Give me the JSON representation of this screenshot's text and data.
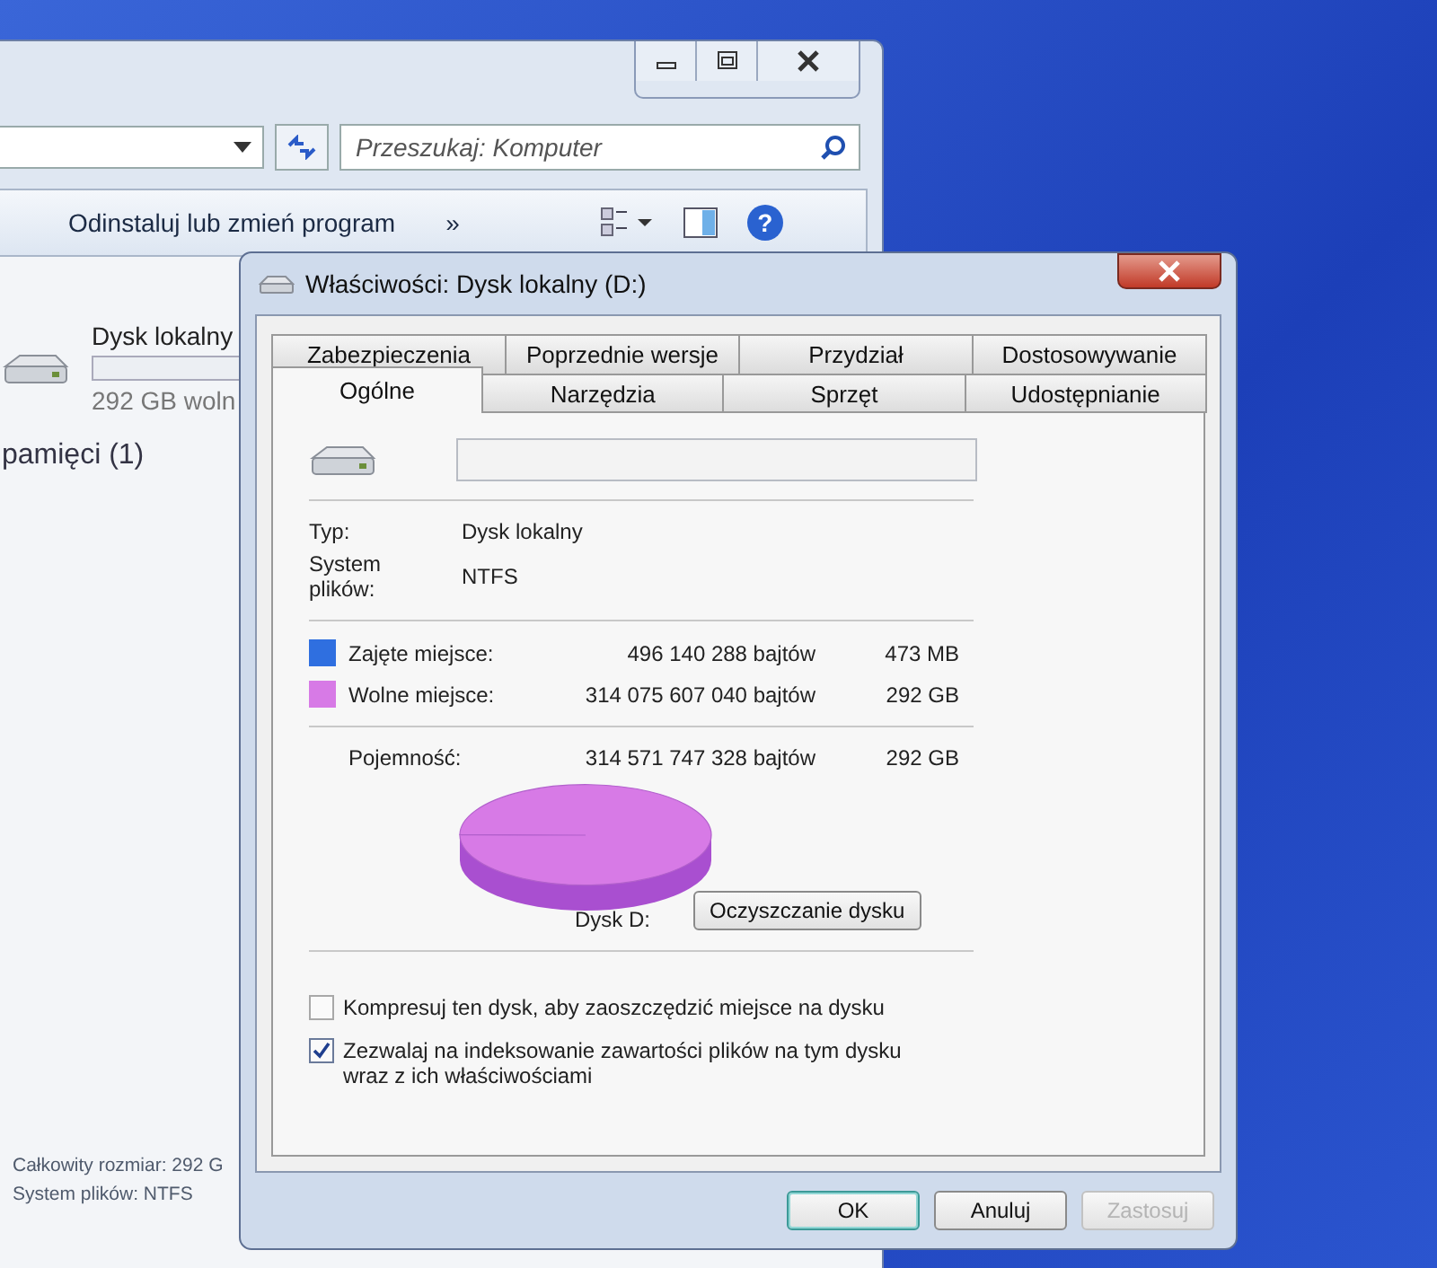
{
  "explorer": {
    "search_placeholder": "Przeszukaj: Komputer",
    "toolbar_item": "Odinstaluj lub zmień program",
    "more": "»",
    "help_glyph": "?",
    "drive": {
      "name": "Dysk lokalny",
      "free": "292 GB woln"
    },
    "group_heading": "pamięci (1)",
    "details": [
      "Całkowity rozmiar: 292 G",
      "System plików: NTFS"
    ]
  },
  "dialog": {
    "title": "Właściwości: Dysk lokalny (D:)",
    "tab_rows": [
      [
        {
          "label": "Zabezpieczenia",
          "selected": false
        },
        {
          "label": "Poprzednie wersje",
          "selected": false
        },
        {
          "label": "Przydział",
          "selected": false
        },
        {
          "label": "Dostosowywanie",
          "selected": false
        }
      ],
      [
        {
          "label": "Ogólne",
          "selected": true
        },
        {
          "label": "Narzędzia",
          "selected": false
        },
        {
          "label": "Sprzęt",
          "selected": false
        },
        {
          "label": "Udostępnianie",
          "selected": false
        }
      ]
    ],
    "info": [
      {
        "label": "Typ:",
        "value": "Dysk lokalny"
      },
      {
        "label": "System plików:",
        "value": "NTFS"
      }
    ],
    "usage": [
      {
        "label": "Zajęte miejsce:",
        "bytes": "496 140 288 bajtów",
        "size": "473 MB",
        "color": "#2f6fe0"
      },
      {
        "label": "Wolne miejsce:",
        "bytes": "314 075 607 040 bajtów",
        "size": "292 GB",
        "color": "#d77ae6"
      }
    ],
    "capacity": {
      "label": "Pojemność:",
      "bytes": "314 571 747 328 bajtów",
      "size": "292 GB"
    },
    "drive_label": "Dysk D:",
    "cleanup_button": "Oczyszczanie dysku",
    "options": [
      {
        "label": "Kompresuj ten dysk, aby zaoszczędzić miejsce na dysku",
        "checked": false
      },
      {
        "label": "Zezwalaj na indeksowanie zawartości plików na tym dysku wraz z ich właściwościami",
        "checked": true
      }
    ],
    "buttons": [
      {
        "label": "OK",
        "disabled": false,
        "default": true
      },
      {
        "label": "Anuluj",
        "disabled": false,
        "default": false
      },
      {
        "label": "Zastosuj",
        "disabled": true,
        "default": false
      }
    ]
  }
}
